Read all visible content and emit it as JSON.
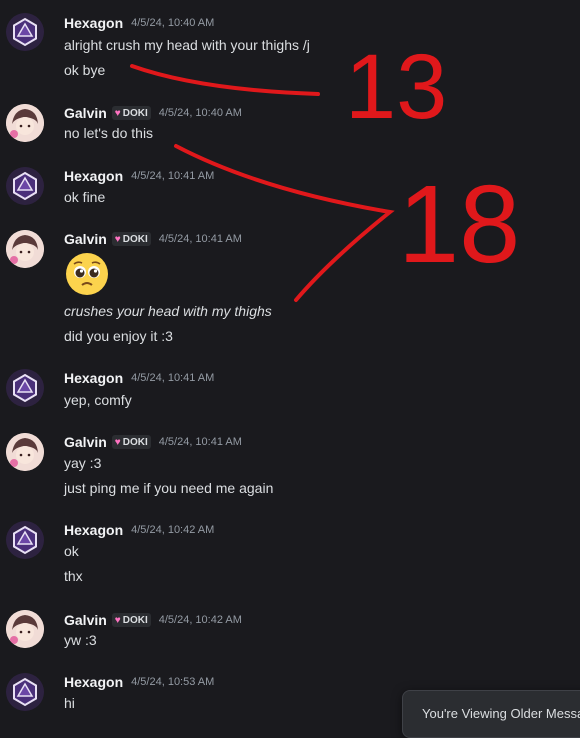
{
  "messages": [
    {
      "author": "Hexagon",
      "timestamp": "4/5/24, 10:40 AM",
      "lines": [
        "alright crush my head with your thighs /j",
        "ok bye"
      ]
    },
    {
      "author": "Galvin",
      "tag": "DOKI",
      "timestamp": "4/5/24, 10:40 AM",
      "lines": [
        "no let's do this"
      ]
    },
    {
      "author": "Hexagon",
      "timestamp": "4/5/24, 10:41 AM",
      "lines": [
        "ok fine"
      ]
    },
    {
      "author": "Galvin",
      "tag": "DOKI",
      "timestamp": "4/5/24, 10:41 AM",
      "emoji": "pleading-face",
      "lines": [
        "crushes your head with my thighs",
        "did you enjoy it :3"
      ]
    },
    {
      "author": "Hexagon",
      "timestamp": "4/5/24, 10:41 AM",
      "lines": [
        "yep, comfy"
      ]
    },
    {
      "author": "Galvin",
      "tag": "DOKI",
      "timestamp": "4/5/24, 10:41 AM",
      "lines": [
        "yay :3",
        "just ping me if you need me again"
      ]
    },
    {
      "author": "Hexagon",
      "timestamp": "4/5/24, 10:42 AM",
      "lines": [
        "ok",
        "thx"
      ]
    },
    {
      "author": "Galvin",
      "tag": "DOKI",
      "timestamp": "4/5/24, 10:42 AM",
      "lines": [
        "yw :3"
      ]
    },
    {
      "author": "Hexagon",
      "timestamp": "4/5/24, 10:53 AM",
      "lines": [
        "hi"
      ]
    }
  ],
  "annotations": {
    "first": "13",
    "second": "18",
    "color": "#e0181b"
  },
  "toast": {
    "text": "You're Viewing Older Messa"
  },
  "colors": {
    "background": "#1a1a1e",
    "author": "#f2f3f5",
    "text": "#dbdee1",
    "timestamp": "#949ba4",
    "tag_heart": "#ff73c2"
  }
}
